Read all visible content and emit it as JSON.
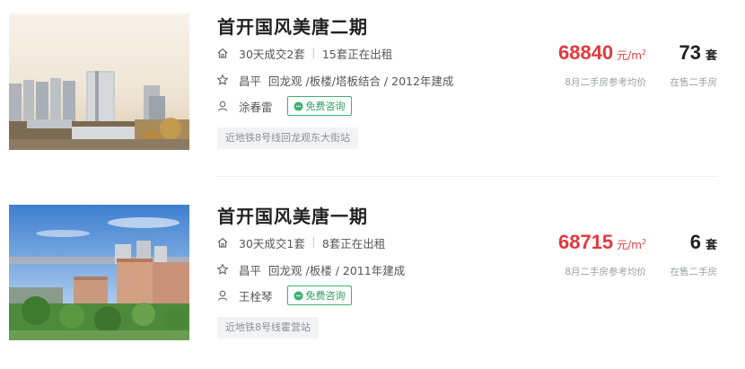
{
  "listings": [
    {
      "title": "首开国风美唐二期",
      "deals": "30天成交2套",
      "rentals": "15套正在出租",
      "district": "昌平",
      "area": "回龙观",
      "attributes": "/板楼/塔板结合 / 2012年建成",
      "agent": "涂春雷",
      "consult_label": "免费咨询",
      "tag": "近地铁8号线回龙观东大街站",
      "price": "68840",
      "price_unit": "元/m",
      "price_unit_sup": "2",
      "price_note": "8月二手房参考均价",
      "count": "73",
      "count_unit": "套",
      "count_note": "在售二手房"
    },
    {
      "title": "首开国风美唐一期",
      "deals": "30天成交1套",
      "rentals": "8套正在出租",
      "district": "昌平",
      "area": "回龙观",
      "attributes": "/板楼 / 2011年建成",
      "agent": "王栓琴",
      "consult_label": "免费咨询",
      "tag": "近地铁8号线霍营站",
      "price": "68715",
      "price_unit": "元/m",
      "price_unit_sup": "2",
      "price_note": "8月二手房参考均价",
      "count": "6",
      "count_unit": "套",
      "count_note": "在售二手房"
    }
  ],
  "icons": {
    "deals": "house-icon",
    "location": "star-icon",
    "agent": "person-icon",
    "consult": "chat-icon"
  },
  "colors": {
    "price": "#e4393c",
    "consult": "#3cb371",
    "tag_bg": "#f1f3f5"
  }
}
